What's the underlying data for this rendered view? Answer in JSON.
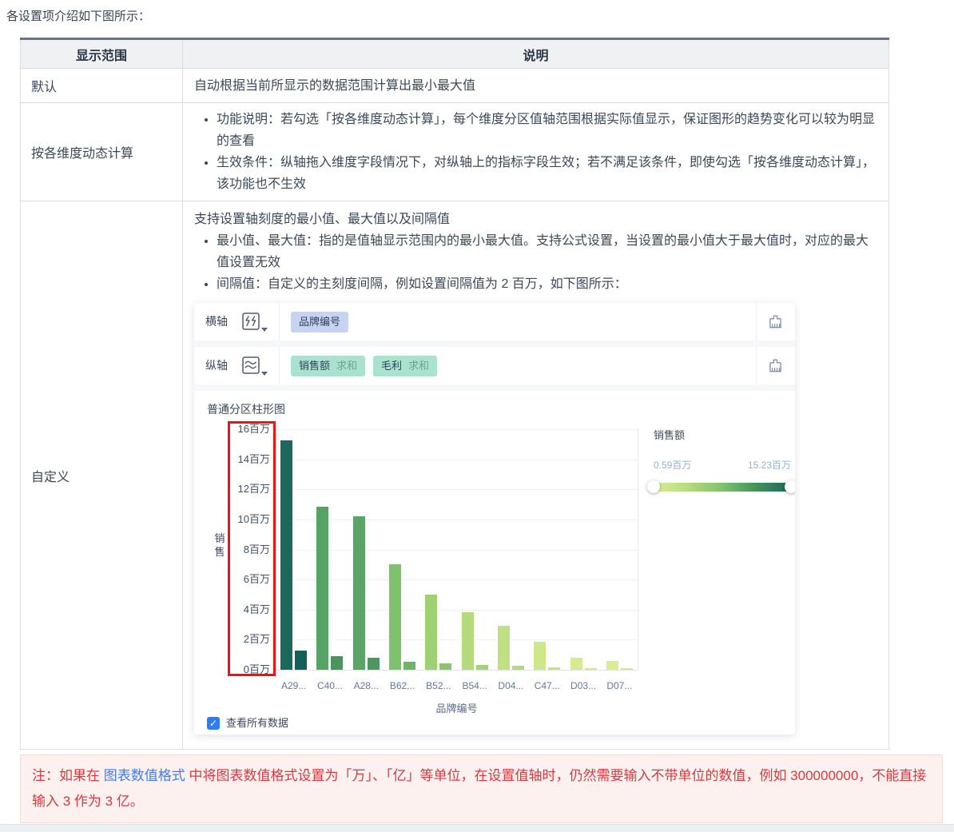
{
  "intro": "各设置项介绍如下图所示：",
  "table": {
    "headers": [
      "显示范围",
      "说明"
    ],
    "rows": [
      {
        "name": "默认",
        "desc": "自动根据当前所显示的数据范围计算出最小最大值"
      },
      {
        "name": "按各维度动态计算",
        "bullets": [
          "功能说明：若勾选「按各维度动态计算」，每个维度分区值轴范围根据实际值显示，保证图形的趋势变化可以较为明显的查看",
          "生效条件：纵轴拖入维度字段情况下，对纵轴上的指标字段生效；若不满足该条件，即使勾选「按各维度动态计算」，该功能也不生效"
        ]
      },
      {
        "name": "自定义",
        "intro": "支持设置轴刻度的最小值、最大值以及间隔值",
        "bullets": [
          "最小值、最大值：指的是值轴显示范围内的最小最大值。支持公式设置，当设置的最小值大于最大值时，对应的最大值设置无效",
          "间隔值：自定义的主刻度间隔，例如设置间隔值为 2 百万，如下图所示："
        ]
      }
    ]
  },
  "panel": {
    "haxis": {
      "label": "横轴",
      "type_icon": "partition-column-icon",
      "tags": [
        {
          "text": "品牌编号"
        }
      ]
    },
    "vaxis": {
      "label": "纵轴",
      "type_icon": "line-chart-icon",
      "tags": [
        {
          "text": "销售额",
          "agg": "求和"
        },
        {
          "text": "毛利",
          "agg": "求和"
        }
      ]
    },
    "clear_icon": "broom-icon",
    "checkbox_label": "查看所有数据",
    "checkbox_checked": true
  },
  "chart_data": {
    "type": "bar",
    "title": "普通分区柱形图",
    "categories": [
      "A29...",
      "C40...",
      "A28...",
      "B62...",
      "B52...",
      "B54...",
      "D04...",
      "C47...",
      "D03...",
      "D07..."
    ],
    "series": [
      {
        "name": "销售额",
        "values": [
          15.23,
          10.85,
          10.2,
          7.0,
          5.0,
          3.85,
          2.9,
          1.85,
          0.8,
          0.59
        ],
        "colors": [
          "#1a695d",
          "#57a363",
          "#5aa565",
          "#7fc16e",
          "#9ed075",
          "#b3da7c",
          "#c0e083",
          "#cde78a",
          "#d5eb8f",
          "#d9ed92"
        ]
      },
      {
        "name": "毛利",
        "values": [
          1.3,
          0.9,
          0.82,
          0.55,
          0.42,
          0.3,
          0.25,
          0.15,
          0.1,
          0.08
        ],
        "colors": [
          "#155f5a",
          "#4c9260",
          "#4f955f",
          "#6fb369",
          "#8ec470",
          "#a5d278",
          "#b4da7e",
          "#c4e287",
          "#cfe88c",
          "#d3ea8f"
        ]
      }
    ],
    "unit": "百万",
    "ylabel": "销售",
    "xlabel": "品牌编号",
    "ylim": [
      0,
      16
    ],
    "ytick_step": 2,
    "yticks": [
      "16百万",
      "14百万",
      "12百万",
      "10百万",
      "8百万",
      "6百万",
      "4百万",
      "2百万",
      "0百万"
    ],
    "grid": true,
    "legend": {
      "position": "right",
      "title": "销售额",
      "min_label": "0.59百万",
      "max_label": "15.23百万",
      "gradient": [
        "#dcee96",
        "#176a5e"
      ]
    },
    "annotations": [
      {
        "type": "red-highlight-box",
        "target": "y-axis-tick-labels"
      }
    ]
  },
  "note": {
    "segments": [
      {
        "text": "注：如果在 "
      },
      {
        "text": "图表数值格式",
        "link": true
      },
      {
        "text": " 中将图表数值格式设置为「万」、「亿」等单位，在设置值轴时，仍然需要输入不带单位的数值，例如 300000000，不能直接输入 3 作为 3 亿。"
      }
    ]
  },
  "colors": {
    "accent_blue": "#2e7cf6",
    "link_blue": "#3e7bfa",
    "note_red": "#d9383f",
    "red_box": "#f21010",
    "tag_blue": "#c6d4f2",
    "tag_green": "#a9e3d0"
  }
}
